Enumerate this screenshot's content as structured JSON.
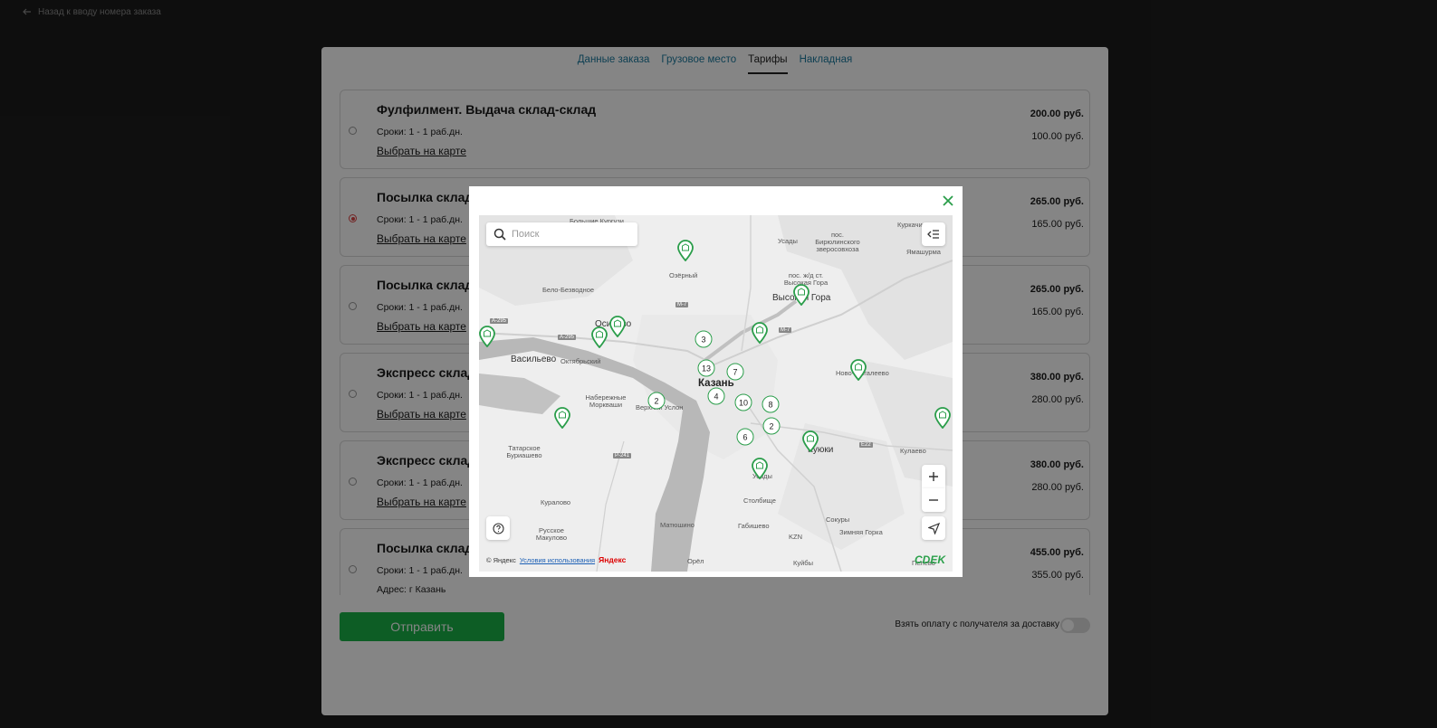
{
  "back_link": "Назад к вводу номера заказа",
  "tabs": [
    {
      "label": "Данные заказа"
    },
    {
      "label": "Грузовое место"
    },
    {
      "label": "Тарифы"
    },
    {
      "label": "Накладная"
    }
  ],
  "active_tab": "Тарифы",
  "tariffs": [
    {
      "name": "Фулфилмент. Выдача склад-склад",
      "term": "Сроки: 1 - 1 раб.дн.",
      "link": "Выбрать на карте",
      "price": "200.00 руб.",
      "price2": "100.00 руб.",
      "selected": false
    },
    {
      "name": "Посылка склад",
      "term": "Сроки: 1 - 1 раб.дн.",
      "link": "Выбрать на карте",
      "price": "265.00 руб.",
      "price2": "165.00 руб.",
      "selected": true
    },
    {
      "name": "Посылка склад",
      "term": "Сроки: 1 - 1 раб.дн.",
      "link": "Выбрать на карте",
      "price": "265.00 руб.",
      "price2": "165.00 руб.",
      "selected": false
    },
    {
      "name": "Экспресс склад",
      "term": "Сроки: 1 - 1 раб.дн.",
      "link": "Выбрать на карте",
      "price": "380.00 руб.",
      "price2": "280.00 руб.",
      "selected": false
    },
    {
      "name": "Экспресс склад",
      "term": "Сроки: 1 - 1 раб.дн.",
      "link": "Выбрать на карте",
      "price": "380.00 руб.",
      "price2": "280.00 руб.",
      "selected": false
    },
    {
      "name": "Посылка склад",
      "term": "Сроки: 1 - 1 раб.дн.",
      "link": "Адрес: г Казань",
      "price": "455.00 руб.",
      "price2": "355.00 руб.",
      "selected": false
    }
  ],
  "submit_label": "Отправить",
  "toggle_label": "Взять оплату с получателя за доставку",
  "toggle_on": false,
  "map": {
    "search_placeholder": "Поиск",
    "clusters": [
      "3",
      "13",
      "7",
      "10",
      "4",
      "8",
      "2",
      "2",
      "6"
    ],
    "places": {
      "kazan": "Казань",
      "vasilevo": "Васильево",
      "oktyabrsky": "Октябрьский",
      "belo": "Бело-Безводное",
      "ozerny": "Озёрный",
      "usady": "Усады",
      "birul": "пос. Бирюлинского зверосовхоза",
      "vyssta": "пос. ж/д ст. Высокая Гора",
      "vysgora": "Высокая Гора",
      "naberezh": "Набережные Моркваши",
      "verkhuslon": "Верхний Услон",
      "tatbur": "Татарское Буриашево",
      "kuralovo": "Куралово",
      "russmak": "Русское Макулово",
      "matyushino": "Матюшино",
      "stolbishche": "Столбище",
      "gabishevo": "Габишево",
      "sokury": "Сокуры",
      "zimnyaya": "Зимняя Горка",
      "kuyuki": "Куюки",
      "kulaevo": "Кулаево",
      "novalgaevo": "Ново-Шигалеево",
      "kurkachi": "Куркачи",
      "yamashurma": "Ямашурма",
      "bolkurgi": "Большие Кургузи",
      "orel": "Орёл",
      "kuyby": "Куйбы",
      "pelevo": "Пелево",
      "kzn": "KZN",
      "usadi2": "Усады",
      "ovo": "Осиново"
    },
    "roads": [
      "М-7",
      "А-295",
      "А-295",
      "М-7",
      "Р-241",
      "Е22"
    ],
    "copyright": "© Яндекс",
    "terms": "Условия использования",
    "yandex": "Яндекс",
    "brand": "CDEK"
  },
  "colors": {
    "accent_green": "#1ab248",
    "pin_green": "#2a9d4a",
    "tab_link": "#1b7a9e",
    "selected_radio": "#dd4444"
  }
}
